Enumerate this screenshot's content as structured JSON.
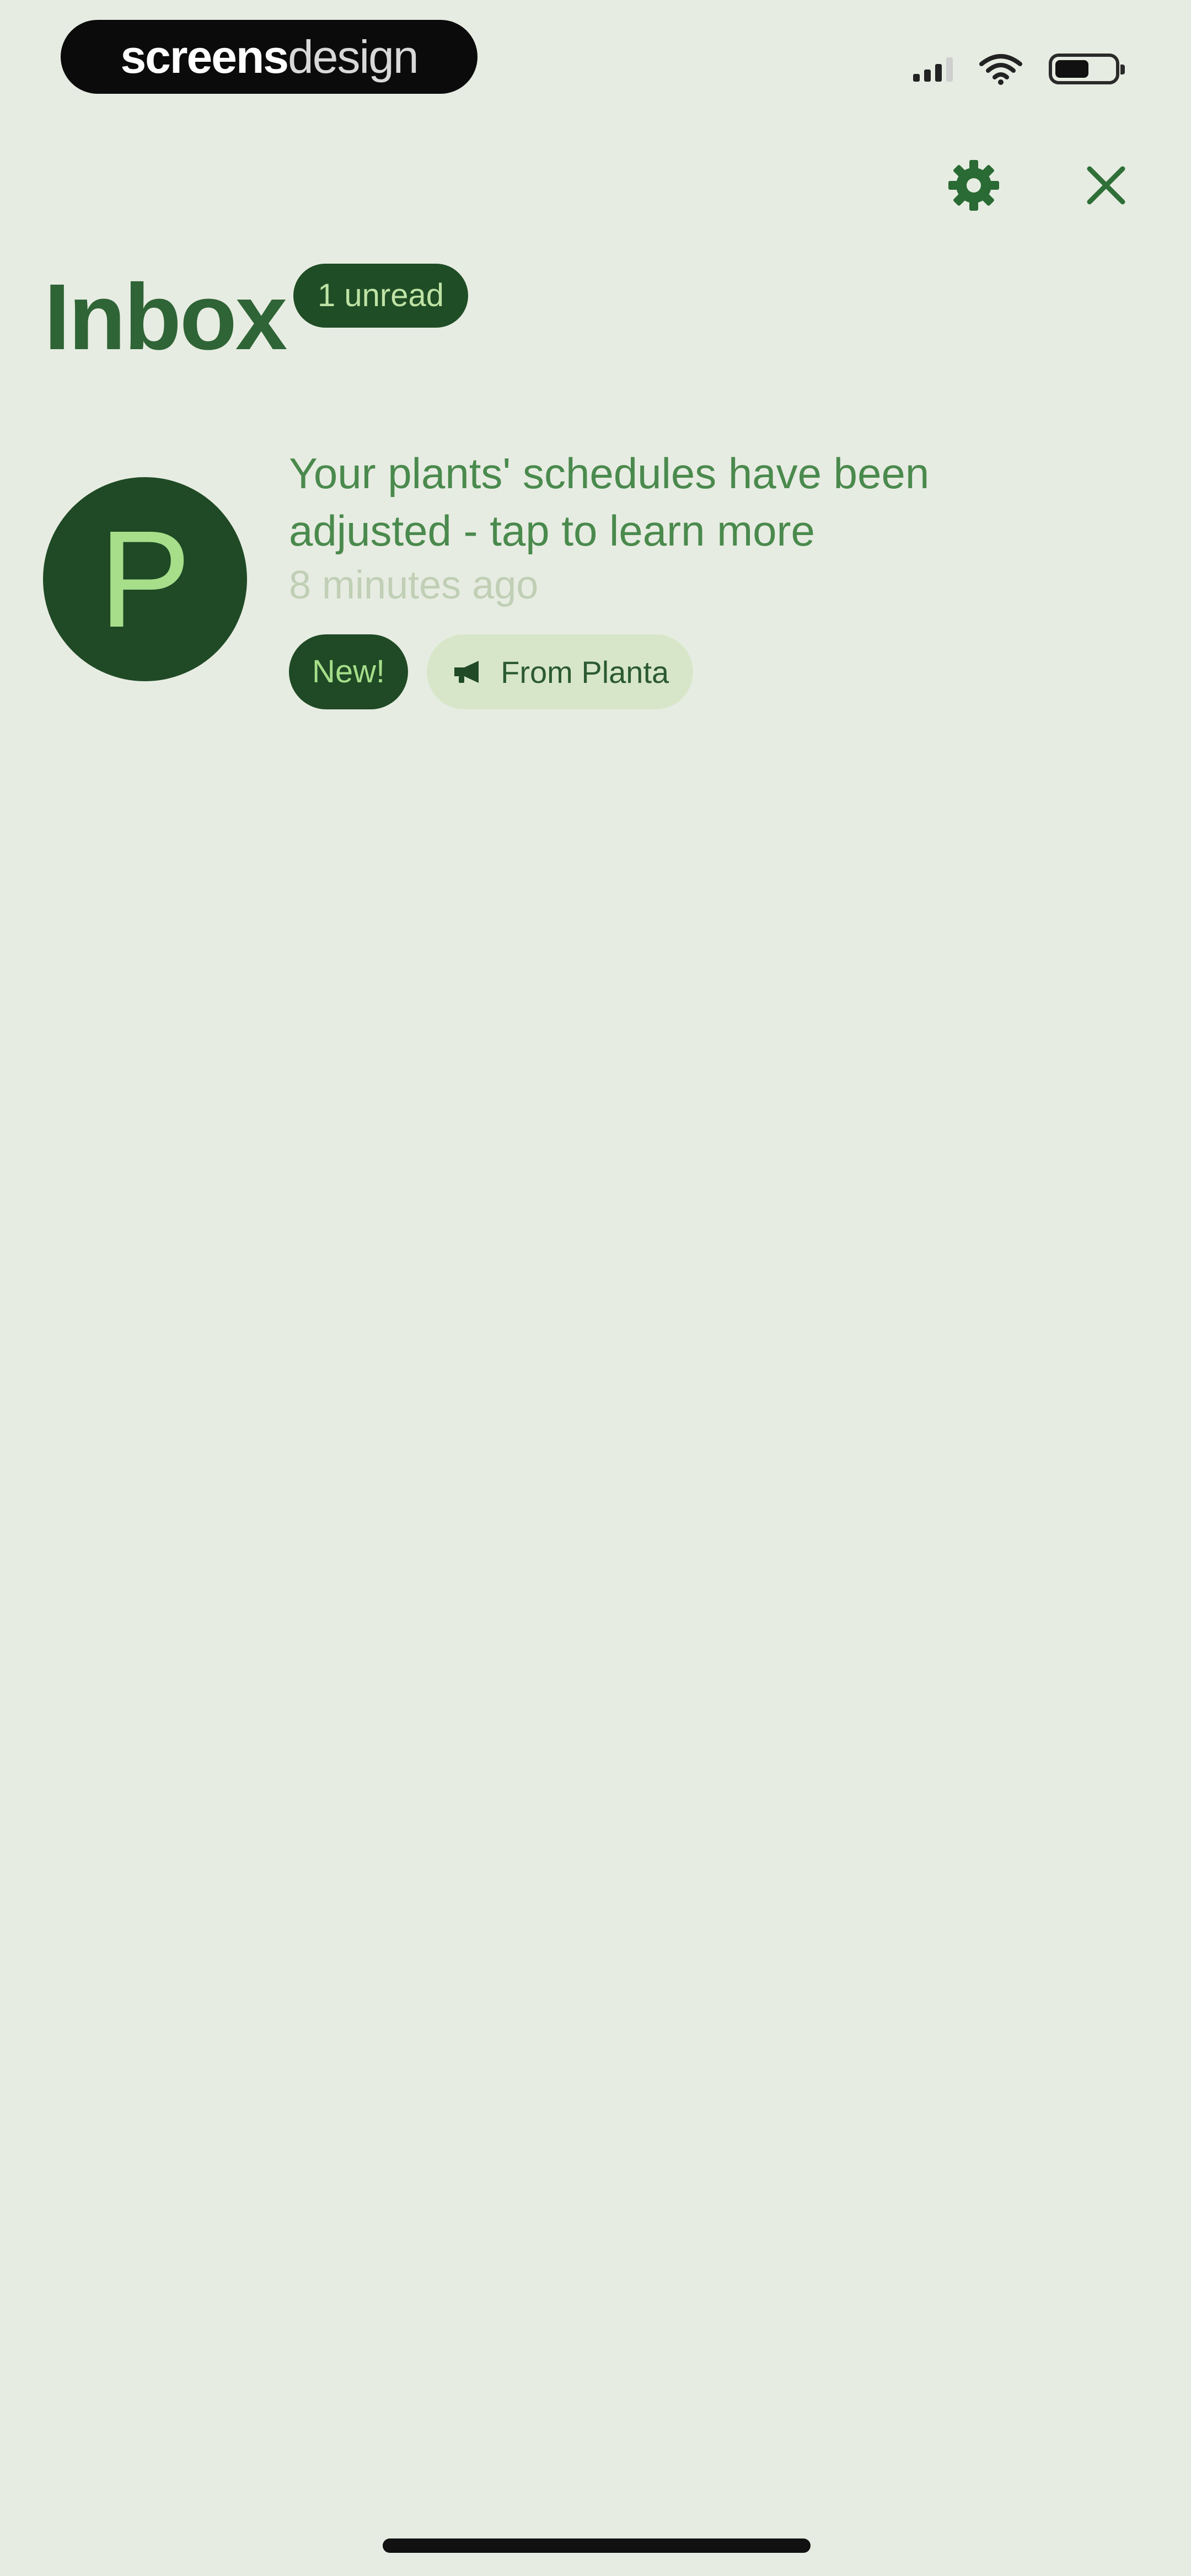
{
  "status_bar": {
    "brand_bold": "screens",
    "brand_light": "design",
    "signal_icon": "cellular-signal-icon",
    "wifi_icon": "wifi-icon",
    "battery_icon": "battery-icon"
  },
  "header": {
    "settings_icon": "gear-icon",
    "close_icon": "close-icon",
    "title": "Inbox",
    "unread_badge": "1 unread"
  },
  "notifications": [
    {
      "avatar_letter": "P",
      "message": "Your plants' schedules have been adjusted - tap to learn more",
      "time": "8 minutes ago",
      "tag_new": "New!",
      "tag_source_icon": "megaphone-icon",
      "tag_source": "From Planta"
    }
  ],
  "colors": {
    "background": "#e7ece2",
    "accent_dark": "#1f4a25",
    "accent_text": "#2f6436",
    "accent_light": "#a6de8a"
  }
}
